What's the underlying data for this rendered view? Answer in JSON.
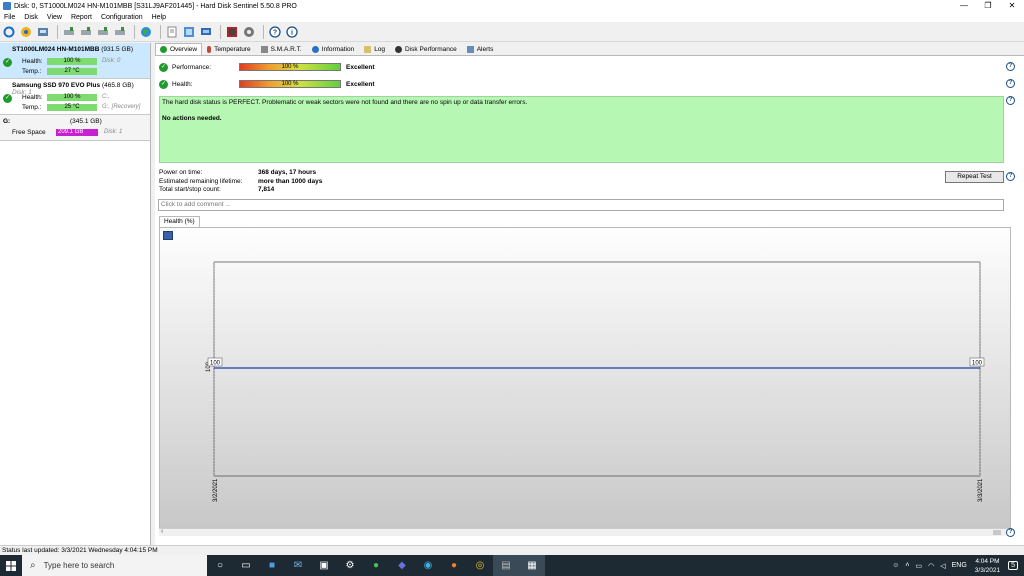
{
  "window": {
    "title": "Disk: 0, ST1000LM024 HN-M101MBB [S31LJ9AF201445]  -  Hard Disk Sentinel 5.50.8 PRO",
    "minimize": "—",
    "maximize": "❐",
    "close": "✕"
  },
  "menu": [
    "File",
    "Disk",
    "View",
    "Report",
    "Configuration",
    "Help"
  ],
  "toolbar_icons": [
    "refresh-icon",
    "scan-icon",
    "disk-icon",
    "drive-icon-1",
    "drive-icon-2",
    "drive-icon-3",
    "drive-icon-4",
    "globe-icon",
    "report-icon",
    "settings-icon",
    "network-icon",
    "chip-icon",
    "gear-icon",
    "help-icon",
    "info-icon"
  ],
  "sidebar": {
    "disks": [
      {
        "name": "ST1000LM024 HN-M101MBB",
        "size": "(931.5 GB)",
        "extra": "",
        "health_label": "Health:",
        "health": "100 %",
        "health_note": "Disk: 0",
        "temp_label": "Temp.:",
        "temp": "27 °C",
        "temp_note": ""
      },
      {
        "name": "Samsung SSD 970 EVO Plus",
        "size": "(465.8 GB)",
        "extra": "Disk: 1",
        "health_label": "Health:",
        "health": "100 %",
        "health_note": "C:,",
        "temp_label": "Temp.:",
        "temp": "25 °C",
        "temp_note": "G:, [Recovery]"
      }
    ],
    "volume": {
      "name": "G:",
      "size": "(345.1 GB)",
      "free_label": "Free Space",
      "free": "209.1 GB",
      "note": "Disk: 1",
      "free_fraction": 0.606
    }
  },
  "tabs": [
    "Overview",
    "Temperature",
    "S.M.A.R.T.",
    "Information",
    "Log",
    "Disk Performance",
    "Alerts"
  ],
  "overview": {
    "performance_label": "Performance:",
    "performance": "100 %",
    "performance_text": "Excellent",
    "health_label": "Health:",
    "health": "100 %",
    "health_text": "Excellent",
    "status_text": "The hard disk status is PERFECT. Problematic or weak sectors were not found and there are no spin up or data transfer errors.",
    "actions_text": "No actions needed.",
    "power_on_label": "Power on time:",
    "power_on": "368 days, 17 hours",
    "lifetime_label": "Estimated remaining lifetime:",
    "lifetime": "more than 1000 days",
    "startstop_label": "Total start/stop count:",
    "startstop": "7,814",
    "repeat_button": "Repeat Test",
    "comment_placeholder": "Click to add comment ...",
    "chart_tab": "Health (%)"
  },
  "chart_data": {
    "type": "line",
    "x": [
      "3/2/2021",
      "3/3/2021"
    ],
    "series": [
      {
        "values": [
          100,
          100
        ]
      }
    ],
    "y_tick": "100",
    "data_labels": [
      "100",
      "100"
    ],
    "color": "#1f3fa8"
  },
  "statusbar": "Status last updated: 3/3/2021 Wednesday 4:04:15 PM",
  "taskbar": {
    "search": "Type here to search",
    "lang": "ENG",
    "time": "4:04 PM",
    "date": "3/3/2021",
    "notif": "5"
  }
}
